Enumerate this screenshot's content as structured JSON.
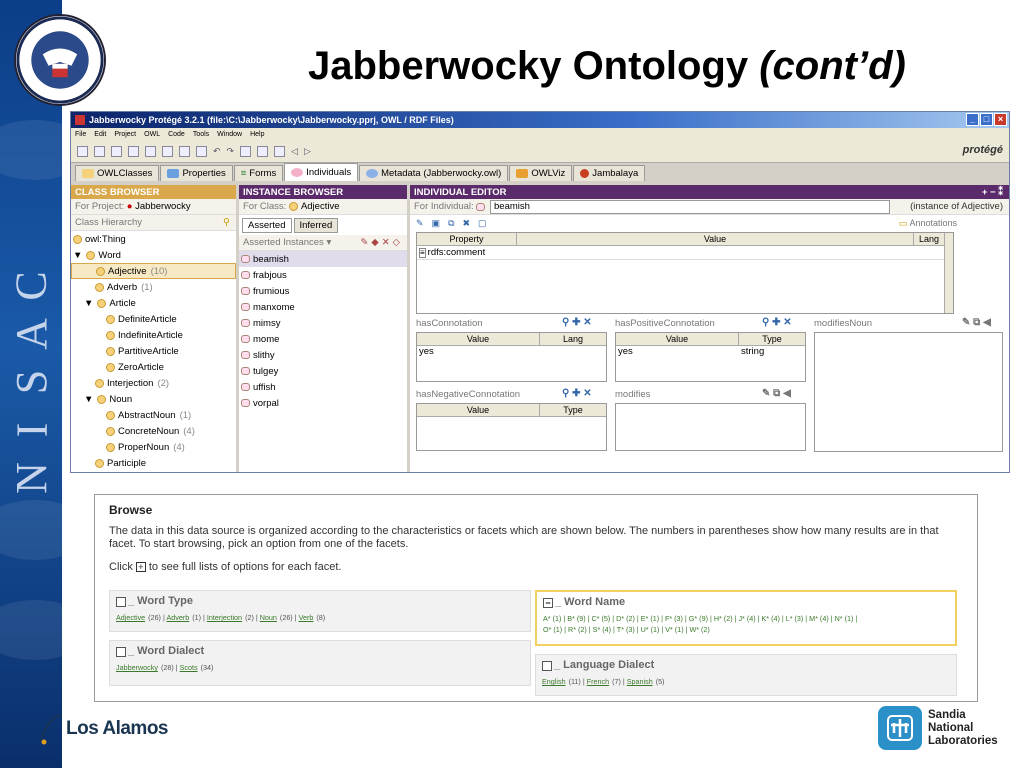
{
  "slide": {
    "title_main": "Jabberwocky Ontology ",
    "title_italic": "(cont’d)",
    "sidebar_text": [
      "N",
      "I",
      "S",
      "A",
      "C"
    ],
    "seal_text": "DEPARTMENT OF HOMELAND SECURITY",
    "footer_left": "Los Alamos",
    "footer_right": [
      "Sandia",
      "National",
      "Laboratories"
    ]
  },
  "window": {
    "title": "Jabberwocky  Protégé 3.2.1    (file:\\C:\\Jabberwocky\\Jabberwocky.pprj, OWL / RDF Files)",
    "menu": [
      "File",
      "Edit",
      "Project",
      "OWL",
      "Code",
      "Tools",
      "Window",
      "Help"
    ],
    "logo": "protégé",
    "tabs": [
      "OWLClasses",
      "Properties",
      "Forms",
      "Individuals",
      "Metadata (Jabberwocky.owl)",
      "OWLViz",
      "Jambalaya"
    ]
  },
  "class_browser": {
    "header": "CLASS BROWSER",
    "for_project_label": "For Project:",
    "project": "Jabberwocky",
    "hierarchy_label": "Class Hierarchy",
    "items": [
      {
        "name": "owl:Thing",
        "count": "",
        "indent": 0,
        "expander": ""
      },
      {
        "name": "Word",
        "count": "",
        "indent": 0,
        "expander": "▼"
      },
      {
        "name": "Adjective",
        "count": "(10)",
        "indent": 2,
        "expander": ""
      },
      {
        "name": "Adverb",
        "count": "(1)",
        "indent": 2,
        "expander": ""
      },
      {
        "name": "Article",
        "count": "",
        "indent": 1,
        "expander": "▼"
      },
      {
        "name": "DefiniteArticle",
        "count": "",
        "indent": 3,
        "expander": ""
      },
      {
        "name": "IndefiniteArticle",
        "count": "",
        "indent": 3,
        "expander": ""
      },
      {
        "name": "PartitiveArticle",
        "count": "",
        "indent": 3,
        "expander": ""
      },
      {
        "name": "ZeroArticle",
        "count": "",
        "indent": 3,
        "expander": ""
      },
      {
        "name": "Interjection",
        "count": "(2)",
        "indent": 2,
        "expander": ""
      },
      {
        "name": "Noun",
        "count": "",
        "indent": 1,
        "expander": "▼"
      },
      {
        "name": "AbstractNoun",
        "count": "(1)",
        "indent": 3,
        "expander": ""
      },
      {
        "name": "ConcreteNoun",
        "count": "(4)",
        "indent": 3,
        "expander": ""
      },
      {
        "name": "ProperNoun",
        "count": "(4)",
        "indent": 3,
        "expander": ""
      },
      {
        "name": "Participle",
        "count": "",
        "indent": 2,
        "expander": ""
      }
    ]
  },
  "instance_browser": {
    "header": "INSTANCE BROWSER",
    "for_class_label": "For Class:",
    "class": "Adjective",
    "subtabs": [
      "Asserted",
      "Inferred"
    ],
    "list_label": "Asserted Instances",
    "instances": [
      "beamish",
      "frabjous",
      "frumious",
      "manxome",
      "mimsy",
      "mome",
      "slithy",
      "tulgey",
      "uffish",
      "vorpal"
    ]
  },
  "individual_editor": {
    "header": "INDIVIDUAL EDITOR",
    "for_individual_label": "For Individual:",
    "individual": "beamish",
    "instance_of": "(instance of Adjective)",
    "annotations_label": "Annotations",
    "annot_cols": [
      "Property",
      "Value",
      "Lang"
    ],
    "annot_row": "rdfs:comment",
    "slots": {
      "hasConnotation": {
        "label": "hasConnotation",
        "cols": [
          "Value",
          "Lang"
        ],
        "value": "yes",
        "extra": ""
      },
      "hasPositiveConnotation": {
        "label": "hasPositiveConnotation",
        "cols": [
          "Value",
          "Type"
        ],
        "value": "yes",
        "extra": "string"
      },
      "modifiesNoun": {
        "label": "modifiesNoun"
      },
      "hasNegativeConnotation": {
        "label": "hasNegativeConnotation",
        "cols": [
          "Value",
          "Type"
        ]
      },
      "modifies": {
        "label": "modifies"
      }
    }
  },
  "browse": {
    "title": "Browse",
    "intro": "The data in this data source is organized according to the characteristics or facets which are shown below. The numbers in parentheses show how many results are in that facet. To start browsing, pick an option from one of the facets.",
    "click_pre": "Click",
    "click_post": "to see full lists of options for each facet.",
    "facets": {
      "word_type": {
        "title": "_ Word Type",
        "links": [
          "Adjective",
          "Adverb",
          "Interjection",
          "Noun",
          "Verb"
        ],
        "counts": [
          "(26)",
          "(1)",
          "(2)",
          "(26)",
          "(8)"
        ]
      },
      "word_name": {
        "title": "_ Word Name",
        "line1": "A* (1) | B* (9) | C* (5) | D* (2) | E* (1) | F* (3) | G* (9) | H* (2) | J* (4) | K* (4) | L* (3) | M* (4) | N* (1) |",
        "line2": "O* (1) | R* (2) | S* (4) | T* (3) | U* (1) | V* (1) | W* (2)"
      },
      "word_dialect": {
        "title": "_ Word Dialect",
        "links": [
          "Jabberwocky",
          "Scots"
        ],
        "counts": [
          "(28)",
          "(34)"
        ]
      },
      "language_dialect": {
        "title": "_ Language Dialect",
        "links": [
          "English",
          "French",
          "Spanish"
        ],
        "counts": [
          "(11)",
          "(7)",
          "(5)"
        ]
      }
    }
  }
}
